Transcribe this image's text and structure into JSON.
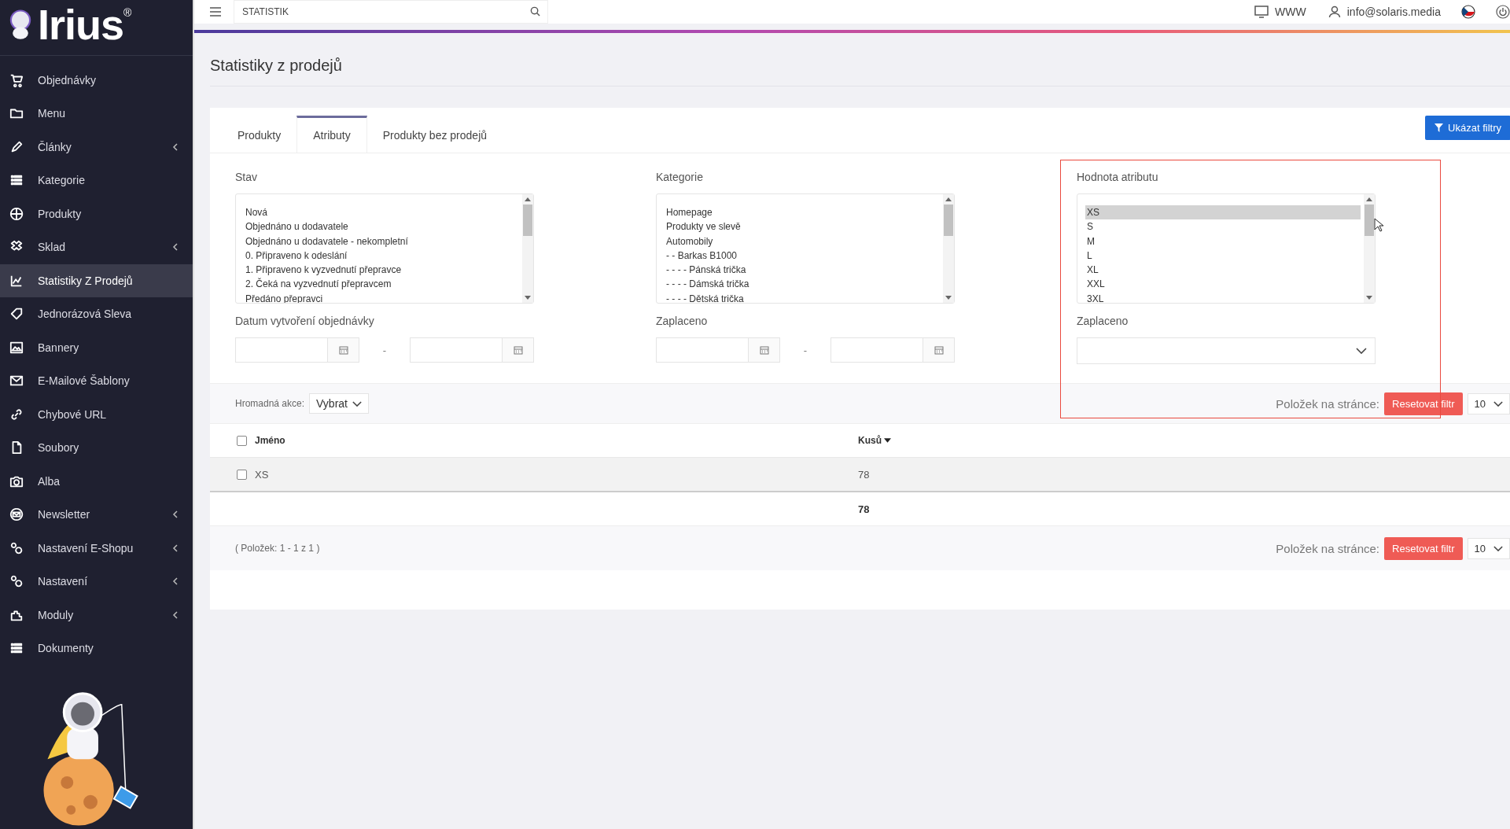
{
  "logo": {
    "text": "Irius",
    "mark": "®"
  },
  "sidebar": {
    "items": [
      {
        "label": "Objednávky",
        "selected": false,
        "expandable": false
      },
      {
        "label": "Menu",
        "selected": false,
        "expandable": false
      },
      {
        "label": "Články",
        "selected": false,
        "expandable": true
      },
      {
        "label": "Kategorie",
        "selected": false,
        "expandable": false
      },
      {
        "label": "Produkty",
        "selected": false,
        "expandable": false
      },
      {
        "label": "Sklad",
        "selected": false,
        "expandable": true
      },
      {
        "label": "Statistiky Z Prodejů",
        "selected": true,
        "expandable": false
      },
      {
        "label": "Jednorázová Sleva",
        "selected": false,
        "expandable": false
      },
      {
        "label": "Bannery",
        "selected": false,
        "expandable": false
      },
      {
        "label": "E-Mailové Šablony",
        "selected": false,
        "expandable": false
      },
      {
        "label": "Chybové URL",
        "selected": false,
        "expandable": false
      },
      {
        "label": "Soubory",
        "selected": false,
        "expandable": false
      },
      {
        "label": "Alba",
        "selected": false,
        "expandable": false
      },
      {
        "label": "Newsletter",
        "selected": false,
        "expandable": true
      },
      {
        "label": "Nastavení E-Shopu",
        "selected": false,
        "expandable": true
      },
      {
        "label": "Nastavení",
        "selected": false,
        "expandable": true
      },
      {
        "label": "Moduly",
        "selected": false,
        "expandable": true
      },
      {
        "label": "Dokumenty",
        "selected": false,
        "expandable": false
      }
    ]
  },
  "topbar": {
    "search": {
      "value": "STATISTIK"
    },
    "links": [
      "WWW",
      "info@solaris.media"
    ]
  },
  "page_title": "Statistiky z prodejů",
  "tabs": [
    {
      "label": "Produkty",
      "selected": false
    },
    {
      "label": "Atributy",
      "selected": true
    },
    {
      "label": "Produkty bez prodejů",
      "selected": false
    }
  ],
  "filter_button": "Ukázat filtry",
  "filters": [
    {
      "label": "Stav",
      "highlighted": false,
      "options": [
        {
          "text": "Nová",
          "selected": false
        },
        {
          "text": "Objednáno u dodavatele",
          "selected": false
        },
        {
          "text": "Objednáno u dodavatele - nekompletní",
          "selected": false
        },
        {
          "text": "0. Připraveno k odeslání",
          "selected": false
        },
        {
          "text": "1. Připraveno k vyzvednutí přepravce",
          "selected": false
        },
        {
          "text": "2. Čeká na vyzvednutí přepravcem",
          "selected": false
        },
        {
          "text": "Předáno přepravci",
          "selected": false
        }
      ]
    },
    {
      "label": "Kategorie",
      "highlighted": false,
      "options": [
        {
          "text": "Homepage",
          "selected": false
        },
        {
          "text": "Produkty ve slevě",
          "selected": false
        },
        {
          "text": "Automobily",
          "selected": false
        },
        {
          "text": "- - Barkas B1000",
          "selected": false
        },
        {
          "text": "- - - - Pánská trička",
          "selected": false
        },
        {
          "text": "- - - - Dámská trička",
          "selected": false
        },
        {
          "text": "- - - - Dětská trička",
          "selected": false
        }
      ]
    },
    {
      "label": "Hodnota atributu",
      "highlighted": true,
      "options": [
        {
          "text": "XS",
          "selected": true
        },
        {
          "text": "S",
          "selected": false
        },
        {
          "text": "M",
          "selected": false
        },
        {
          "text": "L",
          "selected": false
        },
        {
          "text": "XL",
          "selected": false
        },
        {
          "text": "XXL",
          "selected": false
        },
        {
          "text": "3XL",
          "selected": false
        }
      ]
    }
  ],
  "second_filters": [
    {
      "label": "Datum vytvoření objednávky",
      "kind": "daterange",
      "separator": "-"
    },
    {
      "label": "Zaplaceno",
      "kind": "daterange",
      "separator": "-"
    },
    {
      "label": "Zaplaceno",
      "kind": "select"
    }
  ],
  "bulk": {
    "label": "Hromadná akce:",
    "value": "Vybrat"
  },
  "pager": {
    "label": "Položek na stránce:",
    "reset": "Resetovat filtr",
    "per_page": "10"
  },
  "table": {
    "columns": [
      "Jméno",
      "Kusů"
    ],
    "rows": [
      {
        "name": "XS",
        "count": "78",
        "checked": false
      }
    ],
    "total": "78",
    "header_checked": false
  },
  "footer": {
    "summary": "( Položek: 1 - 1 z 1 )",
    "pager": {
      "label": "Položek na stránce:",
      "reset": "Resetovat filtr",
      "per_page": "10"
    }
  }
}
